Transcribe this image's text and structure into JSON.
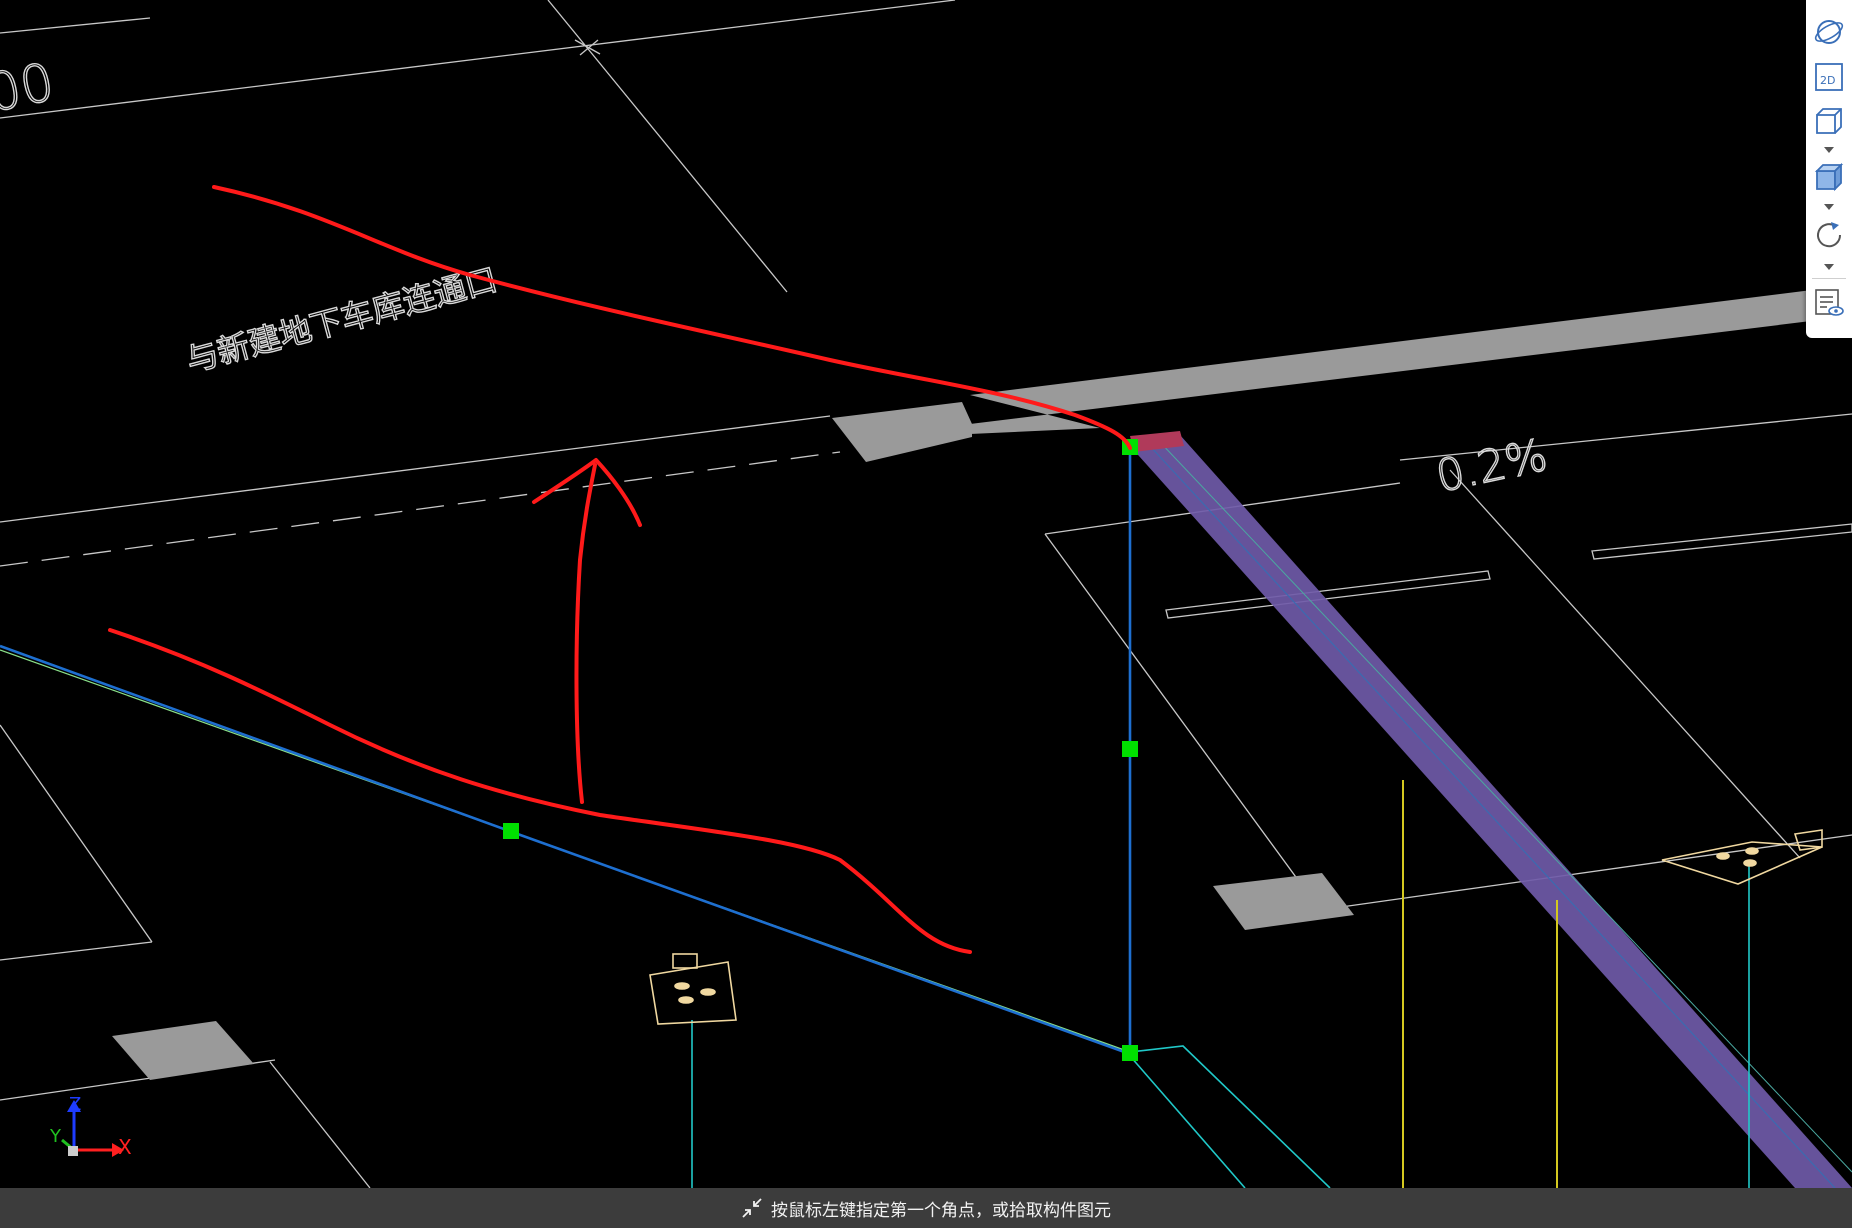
{
  "viewport": {
    "annotation_text": "与新建地下车库连通口",
    "slope_text": "0.2%",
    "corner_text": "00"
  },
  "axis_indicator": {
    "x_label": "X",
    "y_label": "Y",
    "z_label": "Z"
  },
  "toolbar": {
    "items": [
      {
        "name": "orbit",
        "icon": "orbit-icon",
        "label": ""
      },
      {
        "name": "2d-view",
        "icon": "2d-view-icon",
        "label": "2D"
      },
      {
        "name": "3d-box-view",
        "icon": "wireframe-cube-icon",
        "label": ""
      },
      {
        "name": "shaded-view",
        "icon": "shaded-cube-icon",
        "label": ""
      },
      {
        "name": "rotate",
        "icon": "rotate-icon",
        "label": ""
      },
      {
        "name": "display-settings",
        "icon": "layer-visibility-icon",
        "label": ""
      }
    ]
  },
  "status_bar": {
    "prompt": "按鼠标左键指定第一个角点，或拾取构件图元"
  },
  "colors": {
    "background": "#000000",
    "cad_line": "#c8c8c8",
    "grip": "#00e000",
    "pipe": "#1e6fd0",
    "cyan_pipe": "#20c8c8",
    "yellow_line": "#d4c820",
    "purple_beam": "#7b62b4",
    "markup": "#ff1a1a",
    "slab": "#9a9a9a",
    "fixture": "#f0d8a0"
  }
}
